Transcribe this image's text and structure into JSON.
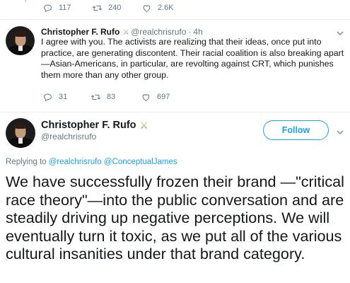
{
  "top_actions": {
    "reply_count": "117",
    "retweet_count": "240",
    "like_count": "2.6K"
  },
  "reply_tweet": {
    "name": "Christopher F. Rufo",
    "badge": "⚔",
    "handle": "@realchrisrufo",
    "separator": "·",
    "time": "4h",
    "text": "I agree with you. The activists are realizing that their ideas, once put into practice, are generating discontent. Their racial coalition is also breaking apart—Asian-Americans, in particular, are revolting against CRT, which punishes them more than any other group.",
    "reply_count": "31",
    "retweet_count": "83",
    "like_count": "697"
  },
  "main_tweet": {
    "name": "Christopher F. Rufo",
    "badge": "⚔",
    "handle": "@realchrisrufo",
    "follow_label": "Follow",
    "replying_prefix": "Replying to",
    "replying_to_1": "@realchrisrufo",
    "replying_to_2": "@ConceptualJames",
    "text": "We have successfully frozen their brand —\"critical race theory\"—into the public conversation and are steadily driving up negative perceptions. We will eventually turn it toxic, as we put all of the various cultural insanities under that brand category."
  },
  "colors": {
    "accent": "#1da1f2",
    "secondary_text": "#657786",
    "primary_text": "#14171a",
    "divider": "#e6ecf0"
  },
  "icons": [
    "reply-icon",
    "retweet-icon",
    "like-icon",
    "chevron-down-icon",
    "crossed-swords-icon"
  ]
}
